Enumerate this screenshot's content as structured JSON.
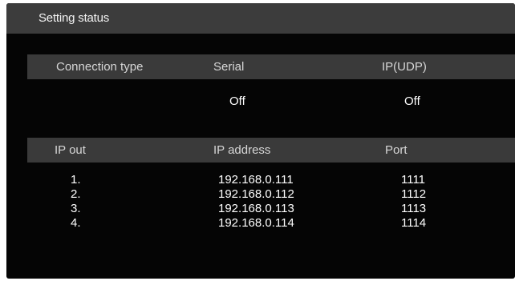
{
  "title": "Setting status",
  "connection": {
    "headers": [
      "Connection type",
      "Serial",
      "IP(UDP)"
    ],
    "values": {
      "serial": "Off",
      "ip_udp": "Off"
    }
  },
  "ip_out": {
    "headers": [
      "IP out",
      "IP address",
      "Port"
    ],
    "rows": [
      {
        "index": "1.",
        "address": "192.168.0.111",
        "port": "1111"
      },
      {
        "index": "2.",
        "address": "192.168.0.112",
        "port": "1112"
      },
      {
        "index": "3.",
        "address": "192.168.0.113",
        "port": "1113"
      },
      {
        "index": "4.",
        "address": "192.168.0.114",
        "port": "1114"
      }
    ]
  }
}
